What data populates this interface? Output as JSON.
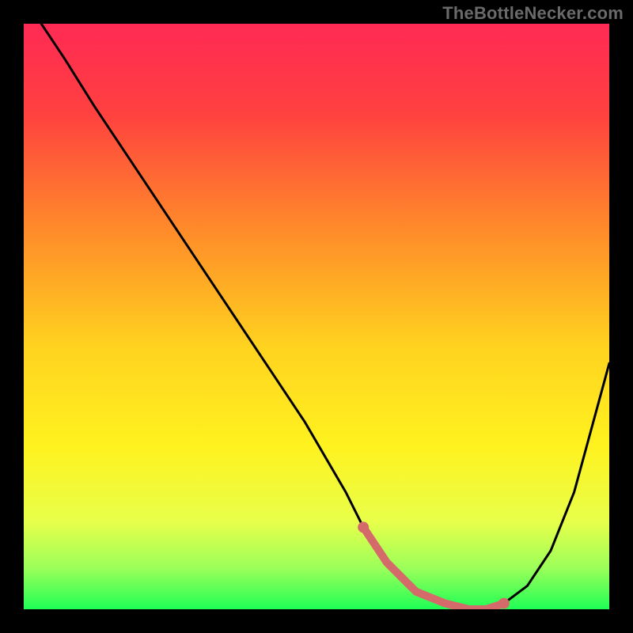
{
  "watermark": "TheBottleNecker.com",
  "chart_data": {
    "type": "line",
    "title": "",
    "xlabel": "",
    "ylabel": "",
    "xlim": [
      0,
      100
    ],
    "ylim": [
      0,
      100
    ],
    "grid": false,
    "series": [
      {
        "name": "bottleneck-curve",
        "x": [
          3,
          7,
          12,
          18,
          24,
          30,
          36,
          42,
          48,
          55,
          58,
          62,
          67,
          72,
          76,
          79,
          82,
          86,
          90,
          94,
          100
        ],
        "y": [
          100,
          94,
          86,
          77,
          68,
          59,
          50,
          41,
          32,
          20,
          14,
          8,
          3,
          1,
          0,
          0,
          1,
          4,
          10,
          20,
          42
        ],
        "color": "#000000"
      }
    ],
    "accent_segment": {
      "name": "sweet-spot",
      "x": [
        58,
        62,
        67,
        72,
        76,
        79,
        82
      ],
      "y": [
        14,
        8,
        3,
        1,
        0,
        0,
        1
      ],
      "color": "#d46a6a"
    },
    "accent_endpoints": {
      "start": {
        "x": 58,
        "y": 14
      },
      "end": {
        "x": 82,
        "y": 1
      }
    },
    "gradient_stops": [
      {
        "offset": 0.0,
        "color": "#ff2a55"
      },
      {
        "offset": 0.15,
        "color": "#ff4040"
      },
      {
        "offset": 0.35,
        "color": "#ff8a2a"
      },
      {
        "offset": 0.55,
        "color": "#ffd21f"
      },
      {
        "offset": 0.72,
        "color": "#fff21f"
      },
      {
        "offset": 0.85,
        "color": "#e8ff4a"
      },
      {
        "offset": 0.93,
        "color": "#9bff5a"
      },
      {
        "offset": 1.0,
        "color": "#1fff55"
      }
    ]
  }
}
